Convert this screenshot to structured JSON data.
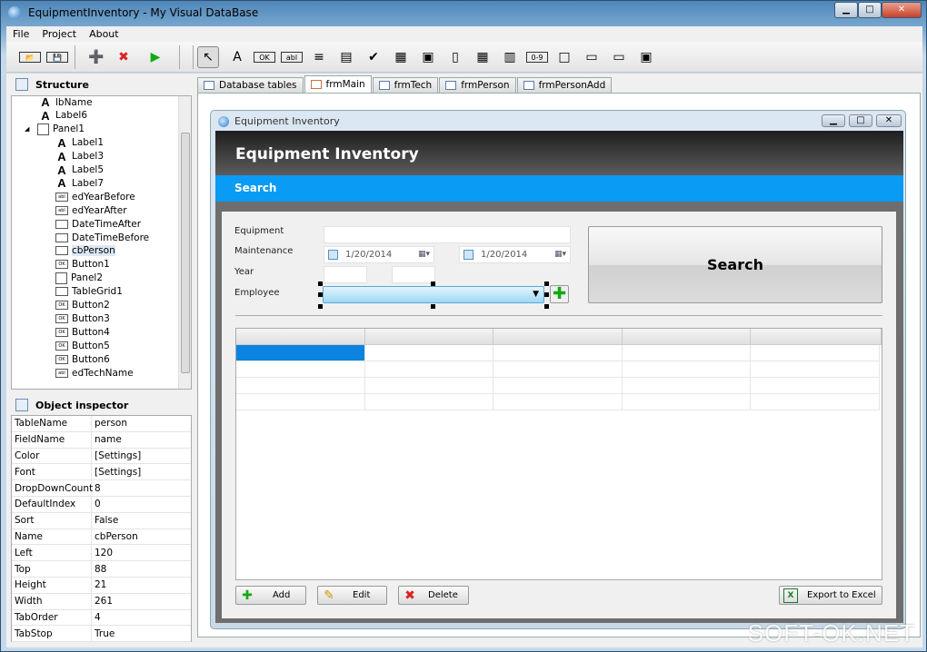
{
  "window": {
    "title": "EquipmentInventory - My Visual DataBase",
    "controls": [
      "▁",
      "□",
      "✕"
    ]
  },
  "menu": [
    "File",
    "Project",
    "About"
  ],
  "toolbar": {
    "tools": [
      {
        "name": "open-icon",
        "g": "📂"
      },
      {
        "name": "save-icon",
        "g": "💾"
      },
      {
        "name": "new-form-icon",
        "g": "➕"
      },
      {
        "name": "delete-form-icon",
        "g": "✖"
      },
      {
        "name": "run-icon",
        "g": "▶"
      },
      {
        "name": "pointer-icon",
        "g": "↖"
      },
      {
        "name": "label-tool-icon",
        "g": "A"
      },
      {
        "name": "button-tool-icon",
        "g": "OK"
      },
      {
        "name": "edit-tool-icon",
        "g": "abl"
      },
      {
        "name": "memo-tool-icon",
        "g": "≡"
      },
      {
        "name": "combobox-tool-icon",
        "g": "▤"
      },
      {
        "name": "checkbox-tool-icon",
        "g": "✔"
      },
      {
        "name": "datetime-tool-icon",
        "g": "▦"
      },
      {
        "name": "dbimage-tool-icon",
        "g": "▣"
      },
      {
        "name": "dbfile-tool-icon",
        "g": "▯"
      },
      {
        "name": "calendar-tool-icon",
        "g": "▦"
      },
      {
        "name": "tablegrid-tool-icon",
        "g": "▥"
      },
      {
        "name": "counter-tool-icon",
        "g": "0-9"
      },
      {
        "name": "panel-tool-icon",
        "g": "□"
      },
      {
        "name": "tab-tool-icon",
        "g": "▭"
      },
      {
        "name": "groupbox-tool-icon",
        "g": "▭"
      },
      {
        "name": "image-tool-icon",
        "g": "▣"
      }
    ]
  },
  "structure": {
    "title": "Structure",
    "items": [
      {
        "label": "lbName",
        "icon": "A",
        "lvl": 2
      },
      {
        "label": "Label6",
        "icon": "A",
        "lvl": 2
      },
      {
        "label": "Panel1",
        "icon": "box",
        "lvl": 1
      },
      {
        "label": "Label1",
        "icon": "A",
        "lvl": 3
      },
      {
        "label": "Label3",
        "icon": "A",
        "lvl": 3
      },
      {
        "label": "Label5",
        "icon": "A",
        "lvl": 3
      },
      {
        "label": "Label7",
        "icon": "A",
        "lvl": 3
      },
      {
        "label": "edYearBefore",
        "icon": "abl",
        "lvl": 3
      },
      {
        "label": "edYearAfter",
        "icon": "abl",
        "lvl": 3
      },
      {
        "label": "DateTimeAfter",
        "icon": "dt",
        "lvl": 3
      },
      {
        "label": "DateTimeBefore",
        "icon": "dt",
        "lvl": 3
      },
      {
        "label": "cbPerson",
        "icon": "cb",
        "lvl": 3
      },
      {
        "label": "Button1",
        "icon": "OK",
        "lvl": 3
      },
      {
        "label": "Panel2",
        "icon": "box",
        "lvl": 3
      },
      {
        "label": "TableGrid1",
        "icon": "grid",
        "lvl": 3
      },
      {
        "label": "Button2",
        "icon": "OK",
        "lvl": 3
      },
      {
        "label": "Button3",
        "icon": "OK",
        "lvl": 3
      },
      {
        "label": "Button4",
        "icon": "OK",
        "lvl": 3
      },
      {
        "label": "Button5",
        "icon": "OK",
        "lvl": 3
      },
      {
        "label": "Button6",
        "icon": "OK",
        "lvl": 3
      },
      {
        "label": "edTechName",
        "icon": "abl",
        "lvl": 3
      }
    ]
  },
  "inspector": {
    "title": "Object inspector",
    "rows": [
      [
        "TableName",
        "person"
      ],
      [
        "FieldName",
        "name"
      ],
      [
        "Color",
        "[Settings]"
      ],
      [
        "Font",
        "[Settings]"
      ],
      [
        "DropDownCount",
        "8"
      ],
      [
        "DefaultIndex",
        "0"
      ],
      [
        "Sort",
        "False"
      ],
      [
        "Name",
        "cbPerson"
      ],
      [
        "Left",
        "120"
      ],
      [
        "Top",
        "88"
      ],
      [
        "Height",
        "21"
      ],
      [
        "Width",
        "261"
      ],
      [
        "TabOrder",
        "4"
      ],
      [
        "TabStop",
        "True"
      ]
    ]
  },
  "tabs": [
    "Database tables",
    "frmMain",
    "frmTech",
    "frmPerson",
    "frmPersonAdd"
  ],
  "form": {
    "window_title": "Equipment Inventory",
    "header": "Equipment Inventory",
    "section": "Search",
    "labels": {
      "equipment": "Equipment",
      "maintenance": "Maintenance",
      "year": "Year",
      "employee": "Employee"
    },
    "date_after": "1/20/2014",
    "date_before": "1/20/2014",
    "search_button": "Search",
    "grid_columns": 5,
    "grid_rows": 4,
    "buttons": {
      "add": "Add",
      "edit": "Edit",
      "delete": "Delete",
      "export": "Export to Excel"
    }
  },
  "watermark": "SOFT-OK.NET",
  "colors": {
    "accent": "#0a9bf4",
    "header": "#2a2a2a"
  }
}
